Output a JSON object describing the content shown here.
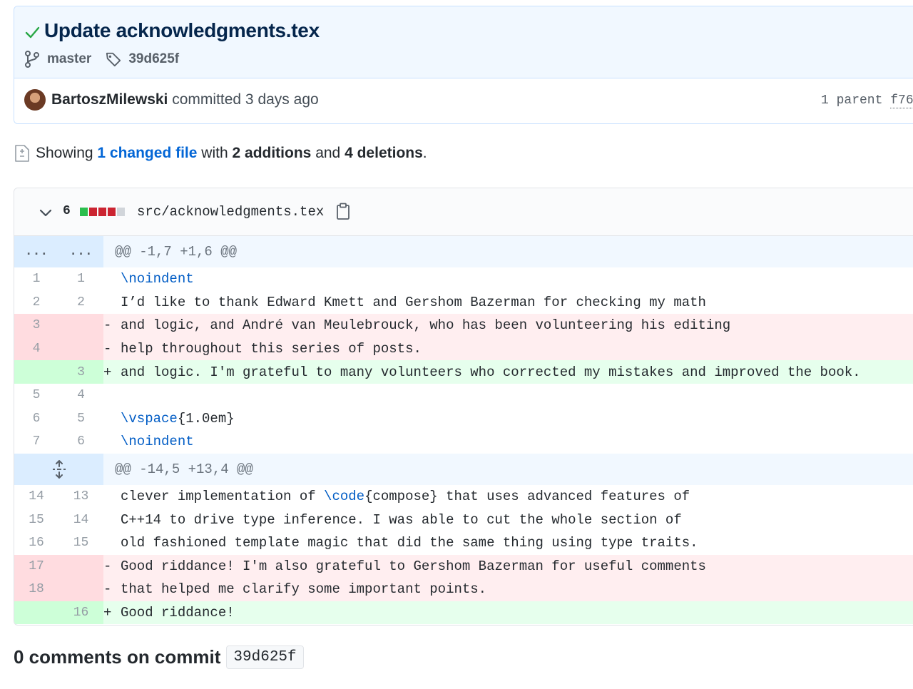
{
  "commit": {
    "title": "Update acknowledgments.tex",
    "branch": "master",
    "tag": "39d625f",
    "author": "BartoszMilewski",
    "action_text": "committed 3 days ago",
    "parent_label": "1 parent",
    "parent_sha": "f76"
  },
  "summary": {
    "prefix": "Showing",
    "changed_link": "1 changed file",
    "mid1": "with",
    "additions": "2 additions",
    "mid2": "and",
    "deletions": "4 deletions",
    "suffix": "."
  },
  "file": {
    "change_count": "6",
    "path": "src/acknowledgments.tex",
    "diffstat": [
      "added",
      "deleted",
      "deleted",
      "deleted",
      "neutral"
    ]
  },
  "diff": {
    "hunk1_header": "@@ -1,7 +1,6 @@",
    "hunk1_left": "...",
    "hunk1_right": "...",
    "hunk1_lines": [
      {
        "type": "ctx",
        "old": "1",
        "new": "1",
        "marker": " ",
        "kw": "\\noindent",
        "text": ""
      },
      {
        "type": "ctx",
        "old": "2",
        "new": "2",
        "marker": " ",
        "kw": "",
        "text": "I’d like to thank Edward Kmett and Gershom Bazerman for checking my math"
      },
      {
        "type": "del",
        "old": "3",
        "new": "",
        "marker": "-",
        "kw": "",
        "text": "and logic, and André van Meulebrouck, who has been volunteering his editing"
      },
      {
        "type": "del",
        "old": "4",
        "new": "",
        "marker": "-",
        "kw": "",
        "text": "help throughout this series of posts."
      },
      {
        "type": "add",
        "old": "",
        "new": "3",
        "marker": "+",
        "kw": "",
        "text": "and logic. I'm grateful to many volunteers who corrected my mistakes and improved the book."
      },
      {
        "type": "ctx",
        "old": "5",
        "new": "4",
        "marker": " ",
        "kw": "",
        "text": ""
      },
      {
        "type": "ctx",
        "old": "6",
        "new": "5",
        "marker": " ",
        "kw": "\\vspace",
        "text": "{1.0em}"
      },
      {
        "type": "ctx",
        "old": "7",
        "new": "6",
        "marker": " ",
        "kw": "\\noindent",
        "text": ""
      }
    ],
    "hunk2_header": "@@ -14,5 +13,4 @@",
    "hunk2_lines": [
      {
        "type": "ctx",
        "old": "14",
        "new": "13",
        "marker": " ",
        "pre": "clever implementation of ",
        "kw": "\\code",
        "text": "{compose} that uses advanced features of"
      },
      {
        "type": "ctx",
        "old": "15",
        "new": "14",
        "marker": " ",
        "pre": "",
        "kw": "",
        "text": "C++14 to drive type inference. I was able to cut the whole section of"
      },
      {
        "type": "ctx",
        "old": "16",
        "new": "15",
        "marker": " ",
        "pre": "",
        "kw": "",
        "text": "old fashioned template magic that did the same thing using type traits."
      },
      {
        "type": "del",
        "old": "17",
        "new": "",
        "marker": "-",
        "pre": "",
        "kw": "",
        "text": "Good riddance! I'm also grateful to Gershom Bazerman for useful comments"
      },
      {
        "type": "del",
        "old": "18",
        "new": "",
        "marker": "-",
        "pre": "",
        "kw": "",
        "text": "that helped me clarify some important points."
      },
      {
        "type": "add",
        "old": "",
        "new": "16",
        "marker": "+",
        "pre": "",
        "kw": "",
        "text": "Good riddance!"
      }
    ]
  },
  "comments": {
    "label": "0 comments on commit",
    "sha": "39d625f"
  },
  "colors": {
    "added": "#2cbe4e",
    "deleted": "#cb2431",
    "neutral": "#d1d5da",
    "link": "#0366d6",
    "keyword": "#005cc5"
  }
}
